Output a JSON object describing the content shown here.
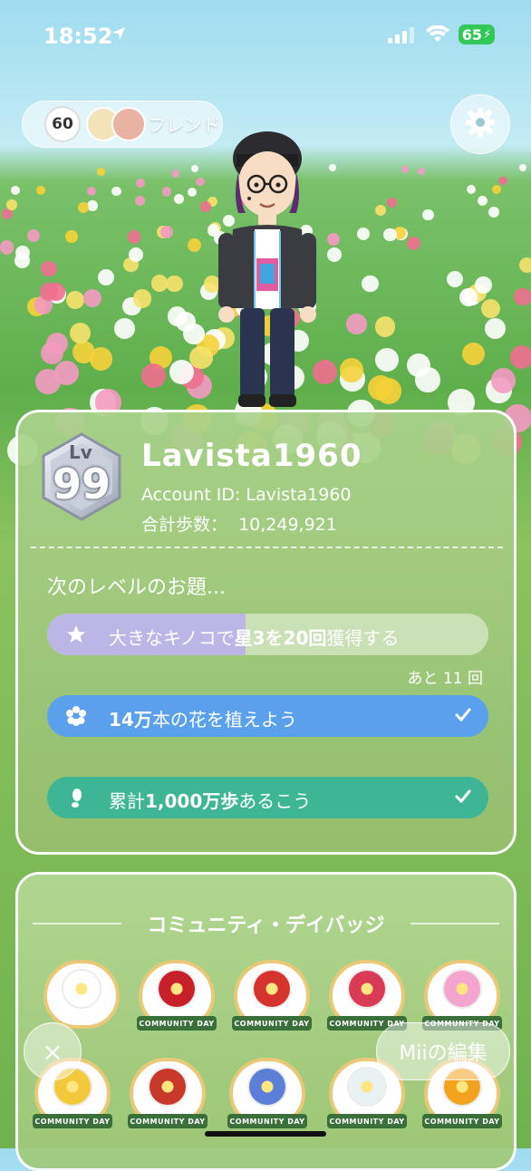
{
  "status_bar": {
    "time": "18:52",
    "battery": "65"
  },
  "friends": {
    "count": "60",
    "label": "フレンド"
  },
  "profile": {
    "level_prefix": "Lv",
    "level": "99",
    "username": "Lavista1960",
    "account_id": "Account ID: Lavista1960",
    "steps_label": "合計歩数：",
    "steps_value": "10,249,921"
  },
  "next_level": {
    "title": "次のレベルのお題...",
    "missions": [
      {
        "pre": "大きなキノコで",
        "bold": "星3を20回",
        "post": "獲得する",
        "icon": "star-icon",
        "progress": 0.45
      },
      {
        "pre": "",
        "bold": "14万",
        "post": "本の花を植えよう",
        "icon": "flower-icon",
        "done": true
      },
      {
        "pre": "累計",
        "bold": "1,000万歩",
        "post": "あるこう",
        "icon": "footprint-icon",
        "done": true
      }
    ],
    "remaining": "あと 11 回"
  },
  "community": {
    "title": "コミュニティ・デイバッジ",
    "badge_ribbon": "COMMUNITY DAY",
    "badges": [
      {
        "name": "white-daisy",
        "color": "#ffffff"
      },
      {
        "name": "poinsettia",
        "color": "#c8202a"
      },
      {
        "name": "camellia",
        "color": "#d6322e"
      },
      {
        "name": "hibiscus",
        "color": "#d93a55"
      },
      {
        "name": "pink-lily",
        "color": "#f3a4cf"
      },
      {
        "name": "tulip",
        "color": "#f3c93b"
      },
      {
        "name": "rose",
        "color": "#c8392c"
      },
      {
        "name": "hydrangea",
        "color": "#5b7fd6"
      },
      {
        "name": "white-lily",
        "color": "#e8f2f2"
      },
      {
        "name": "sunflower",
        "color": "#f2a21c"
      }
    ]
  },
  "buttons": {
    "close": "×",
    "edit_mii": "Miiの編集"
  },
  "colors": {
    "mission_blue": "#5aa0ec",
    "mission_green": "#3eb696",
    "mission_purple": "#bcb6e6"
  }
}
